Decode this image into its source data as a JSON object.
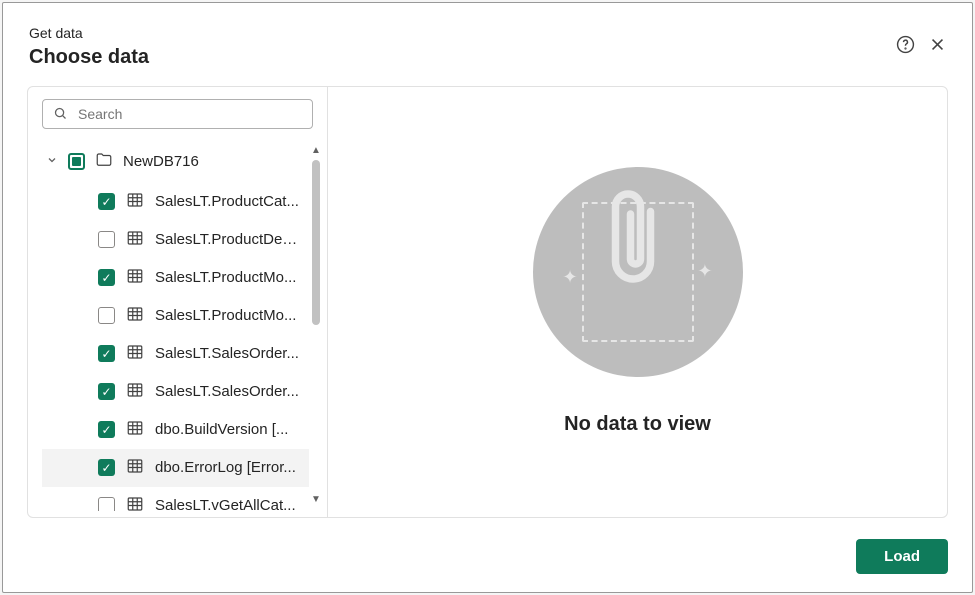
{
  "header": {
    "subtitle": "Get data",
    "title": "Choose data"
  },
  "search": {
    "placeholder": "Search"
  },
  "tree": {
    "root_label": "NewDB716",
    "items": [
      {
        "label": "SalesLT.ProductCat...",
        "checked": true
      },
      {
        "label": "SalesLT.ProductDes...",
        "checked": false
      },
      {
        "label": "SalesLT.ProductMo...",
        "checked": true
      },
      {
        "label": "SalesLT.ProductMo...",
        "checked": false
      },
      {
        "label": "SalesLT.SalesOrder...",
        "checked": true
      },
      {
        "label": "SalesLT.SalesOrder...",
        "checked": true
      },
      {
        "label": "dbo.BuildVersion [...",
        "checked": true
      },
      {
        "label": "dbo.ErrorLog [Error...",
        "checked": true,
        "hover": true
      },
      {
        "label": "SalesLT.vGetAllCat...",
        "checked": false
      }
    ]
  },
  "preview": {
    "empty_message": "No data to view"
  },
  "footer": {
    "load_label": "Load"
  }
}
